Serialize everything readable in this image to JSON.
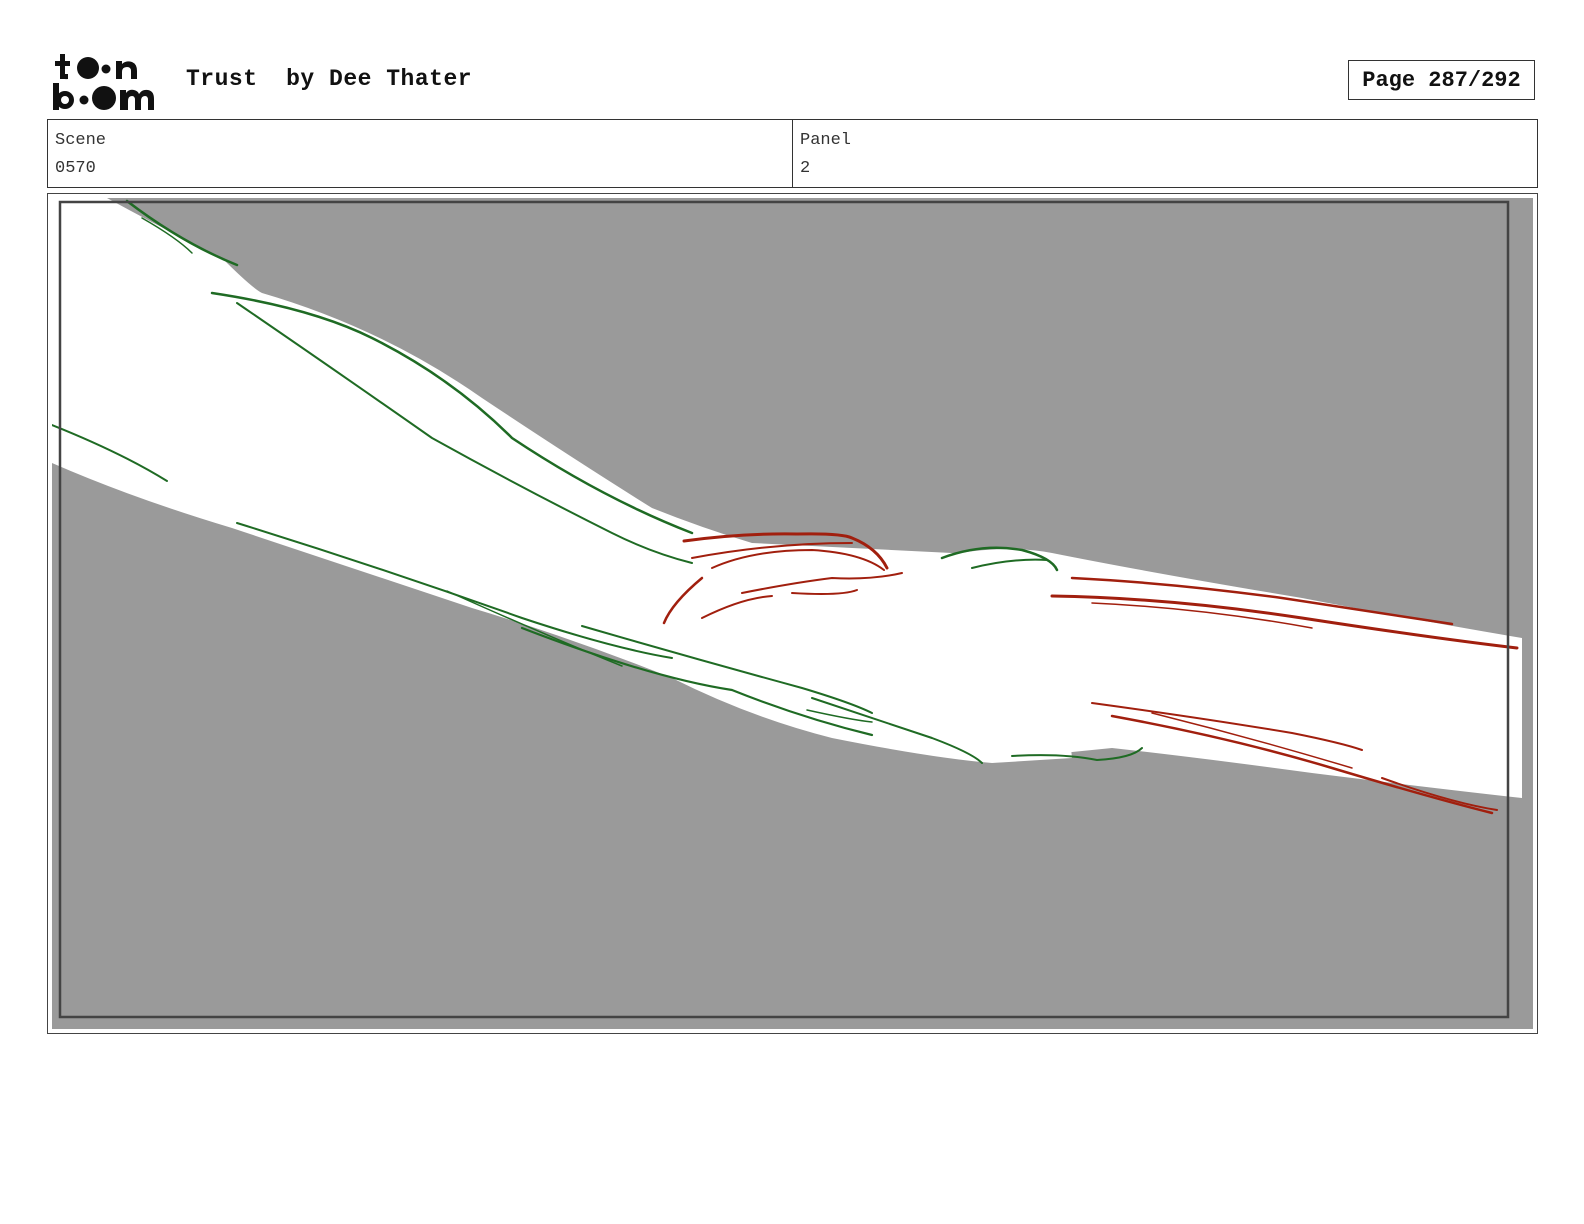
{
  "header": {
    "title": "Trust  by Dee Thater",
    "page_label": "Page 287/292",
    "logo_text": "toon boom"
  },
  "info": {
    "scene_label": "Scene",
    "scene_value": "0570",
    "panel_label": "Panel",
    "panel_value": "2"
  },
  "colors": {
    "background_gray": "#9a9a9a",
    "arm_fill": "#ffffff",
    "left_arm_line": "#1f6b24",
    "right_arm_line": "#a11f0e",
    "frame_line": "#444444"
  }
}
